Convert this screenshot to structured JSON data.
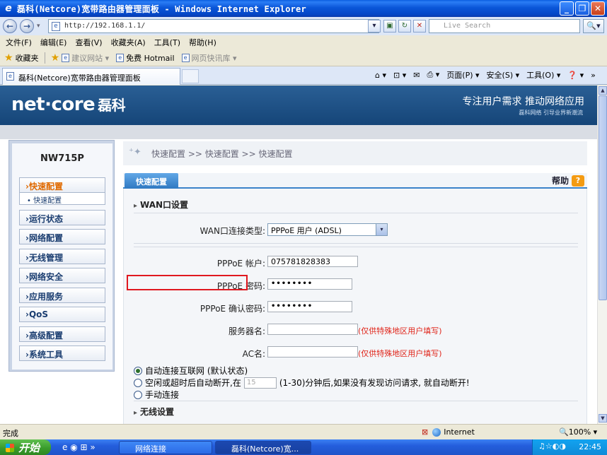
{
  "window": {
    "title": "磊科(Netcore)宽带路由器管理面板 - Windows Internet Explorer"
  },
  "address": {
    "url": "http://192.168.1.1/",
    "search_placeholder": "Live Search"
  },
  "menu": [
    "文件(F)",
    "编辑(E)",
    "查看(V)",
    "收藏夹(A)",
    "工具(T)",
    "帮助(H)"
  ],
  "favorites": {
    "label": "收藏夹",
    "items": [
      "建议网站 ▾",
      "免费 Hotmail",
      "网页快讯库 ▾"
    ]
  },
  "tab": {
    "label": "磊科(Netcore)宽带路由器管理面板"
  },
  "commandbar": [
    "⌂ ▾",
    "⊡ ▾",
    "✉",
    "⎙ ▾",
    "页面(P) ▾",
    "安全(S) ▾",
    "工具(O) ▾",
    "❓ ▾",
    "»"
  ],
  "site": {
    "logo": "net·core",
    "logo_cn": "磊科",
    "slogan": "专注用户需求  推动网络应用",
    "slogan_small": "磊科网络 引导业界新潮流"
  },
  "sidebar": {
    "model": "NW715P",
    "items": [
      {
        "label": "›快速配置",
        "active": true
      },
      {
        "label": "›运行状态"
      },
      {
        "label": "›网络配置"
      },
      {
        "label": "›无线管理"
      },
      {
        "label": "›网络安全"
      },
      {
        "label": "›应用服务"
      },
      {
        "label": "›QoS"
      },
      {
        "label": "›高级配置"
      },
      {
        "label": "›系统工具"
      }
    ],
    "subitem": "• 快速配置"
  },
  "breadcrumb": "快速配置 >> 快速配置 >> 快速配置",
  "content": {
    "tab_label": "快速配置",
    "help_label": "帮助",
    "wan_title": "WAN口设置",
    "wan_type_label": "WAN口连接类型:",
    "wan_type_value": "PPPoE 用户 (ADSL)",
    "pppoe_account_label": "PPPoE 帐户:",
    "pppoe_account_value": "075781828383",
    "pppoe_password_label": "PPPoE 密码:",
    "pppoe_password_value": "••••••••",
    "pppoe_confirm_label": "PPPoE 确认密码:",
    "pppoe_confirm_value": "••••••••",
    "service_label": "服务器名:",
    "service_hint": "(仅供特殊地区用户填写)",
    "ac_label": "AC名:",
    "ac_hint": "(仅供特殊地区用户填写)",
    "radio_auto": "自动连接互联网 (默认状态)",
    "radio_idle_prefix": "空闲或超时后自动断开,在",
    "radio_idle_value": "15",
    "radio_idle_suffix": "(1-30)分钟后,如果没有发现访问请求, 就自动断开!",
    "radio_manual": "手动连接",
    "wireless_title": "无线设置"
  },
  "status": {
    "text": "完成",
    "zone": "Internet",
    "zoom": "🔍100% ▾"
  },
  "taskbar": {
    "start": "开始",
    "tasks": [
      "网络连接",
      "磊科(Netcore)宽..."
    ],
    "clock": "22:45"
  }
}
